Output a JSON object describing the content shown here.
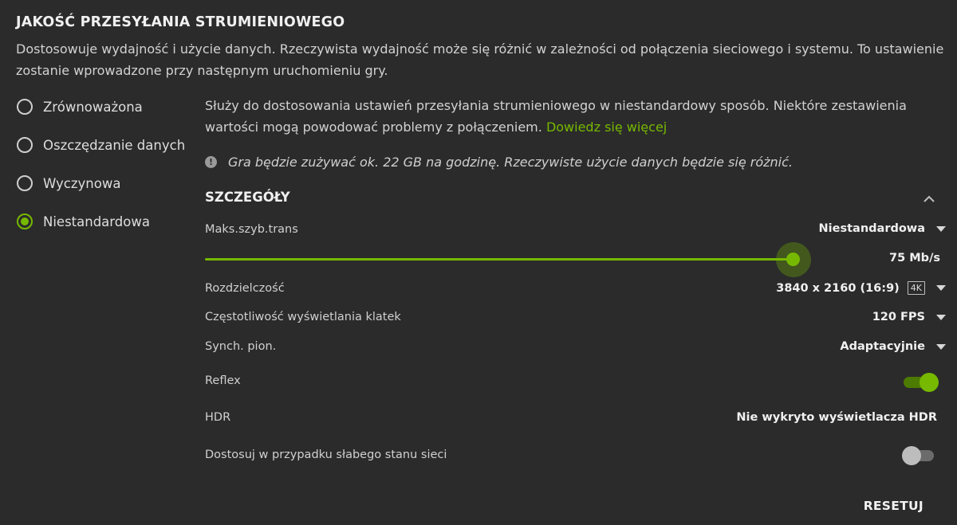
{
  "header": {
    "title": "JAKOŚĆ PRZESYŁANIA STRUMIENIOWEGO",
    "description": "Dostosowuje wydajność i użycie danych. Rzeczywista wydajność może się różnić w zależności od połączenia sieciowego i systemu. To ustawienie zostanie wprowadzone przy następnym uruchomieniu gry."
  },
  "presets": [
    {
      "label": "Zrównoważona",
      "selected": false
    },
    {
      "label": "Oszczędzanie danych",
      "selected": false
    },
    {
      "label": "Wyczynowa",
      "selected": false
    },
    {
      "label": "Niestandardowa",
      "selected": true
    }
  ],
  "custom": {
    "info": "Służy do dostosowania ustawień przesyłania strumieniowego w niestandardowy sposób. Niektóre zestawienia wartości mogą powodować problemy z połączeniem.",
    "link": "Dowiedz się więcej",
    "usage": "Gra będzie zużywać ok. 22 GB na godzinę. Rzeczywiste użycie danych będzie się różnić."
  },
  "details": {
    "title": "SZCZEGÓŁY",
    "bitrate": {
      "label": "Maks.szyb.trans",
      "mode": "Niestandardowa",
      "value": "75 Mb/s",
      "fraction": 0.86
    },
    "resolution": {
      "label": "Rozdzielczość",
      "value": "3840 x 2160 (16:9)",
      "badge": "4K"
    },
    "framerate": {
      "label": "Częstotliwość wyświetlania klatek",
      "value": "120 FPS"
    },
    "vsync": {
      "label": "Synch. pion.",
      "value": "Adaptacyjnie"
    },
    "reflex": {
      "label": "Reflex",
      "on": true
    },
    "hdr": {
      "label": "HDR",
      "value": "Nie wykryto wyświetlacza HDR"
    },
    "adaptive": {
      "label": "Dostosuj w przypadku słabego stanu sieci",
      "on": false
    }
  },
  "actions": {
    "reset": "RESETUJ"
  },
  "colors": {
    "accent": "#76b900",
    "background": "#2b2b2b"
  },
  "icons": {
    "info": "info-icon",
    "collapse": "chevron-up-icon",
    "dropdown": "caret-down-icon"
  }
}
